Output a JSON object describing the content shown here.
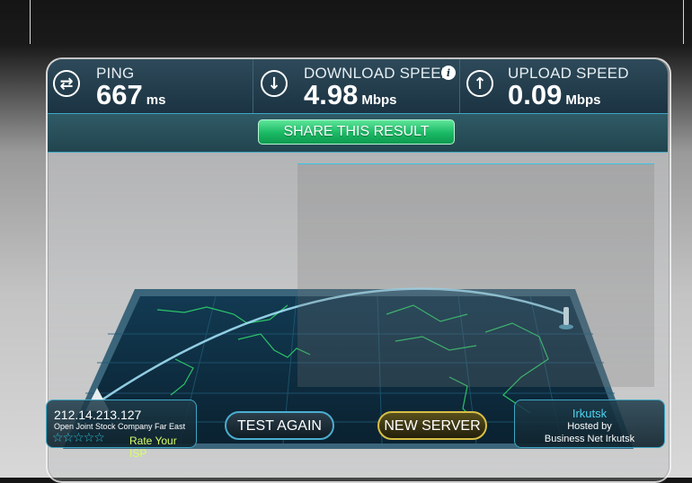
{
  "stats": {
    "ping": {
      "label": "PING",
      "value": "667",
      "unit": "ms",
      "icon": "ping-arrows-icon"
    },
    "download": {
      "label": "DOWNLOAD SPEED",
      "value": "4.98",
      "unit": "Mbps",
      "icon": "download-arrow-icon",
      "info_glyph": "i"
    },
    "upload": {
      "label": "UPLOAD SPEED",
      "value": "0.09",
      "unit": "Mbps",
      "icon": "upload-arrow-icon"
    }
  },
  "share_button": {
    "label": "SHARE THIS RESULT"
  },
  "isp": {
    "ip": "212.14.213.127",
    "name": "Open Joint Stock Company Far East",
    "rating_stars": 5,
    "rating_filled": 0,
    "rate_label": "Rate Your ISP"
  },
  "buttons": {
    "test_again": "TEST AGAIN",
    "new_server": "NEW SERVER"
  },
  "server": {
    "city": "Irkutsk",
    "hosted_label": "Hosted by",
    "host": "Business Net Irkutsk"
  },
  "colors": {
    "accent_cyan": "#38c3e4",
    "share_green": "#19b964",
    "new_server_gold": "#d8bf45",
    "rate_text": "#d9ff6a"
  }
}
